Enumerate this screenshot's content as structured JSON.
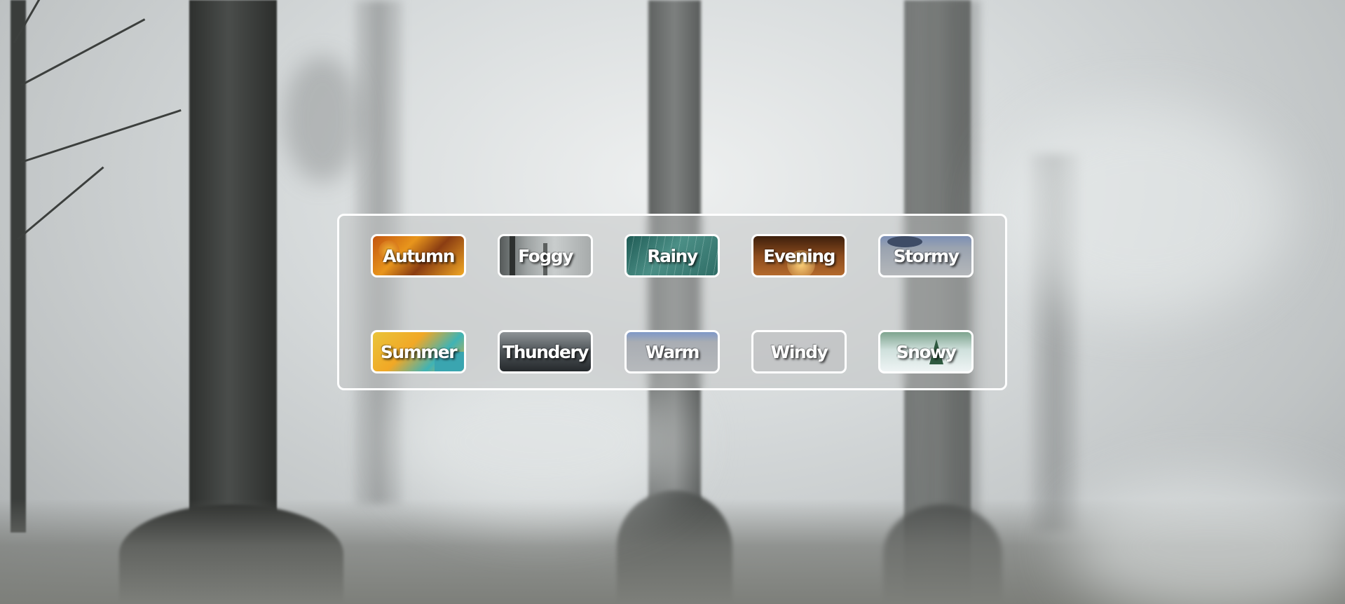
{
  "weather_buttons": {
    "row1": [
      {
        "id": "autumn",
        "label": "Autumn"
      },
      {
        "id": "foggy",
        "label": "Foggy"
      },
      {
        "id": "rainy",
        "label": "Rainy"
      },
      {
        "id": "evening",
        "label": "Evening"
      },
      {
        "id": "stormy",
        "label": "Stormy"
      }
    ],
    "row2": [
      {
        "id": "summer",
        "label": "Summer"
      },
      {
        "id": "thundery",
        "label": "Thundery"
      },
      {
        "id": "warm",
        "label": "Warm"
      },
      {
        "id": "windy",
        "label": "Windy"
      },
      {
        "id": "snowy",
        "label": "Snowy"
      }
    ]
  },
  "colors": {
    "panel_border": "#ffffff",
    "label_text": "#ffffff"
  }
}
